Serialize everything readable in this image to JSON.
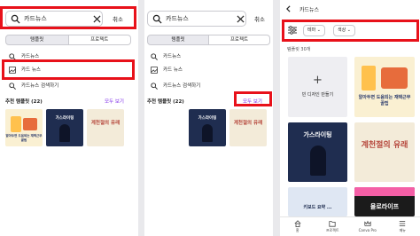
{
  "colors": {
    "accent": "#7d2ae8",
    "highlight": "#e8111a"
  },
  "screen1": {
    "search_value": "카드뉴스",
    "cancel_label": "취소",
    "tabs": [
      "템플릿",
      "프로젝트"
    ],
    "suggestions": [
      "카드뉴스",
      "카드 뉴스",
      "카드뉴스 검색하기"
    ],
    "recommended_title": "추천 템플릿 (22)",
    "see_all": "모두 보기",
    "thumbnails": [
      {
        "title": "알아두면 도움되는 재택근무 꿀팁"
      },
      {
        "title": "가스라이팅"
      },
      {
        "title": "계천절의 유래"
      }
    ]
  },
  "screen2": {
    "search_value": "카드뉴스",
    "cancel_label": "취소",
    "tabs": [
      "템플릿",
      "프로젝트"
    ],
    "suggestions": [
      "카드뉴스",
      "카드 뉴스",
      "카드뉴스 검색하기"
    ],
    "recommended_title": "추천 템플릿 (22)",
    "see_all": "모두 보기",
    "thumbnails": [
      {
        "title": "가스라이팅"
      },
      {
        "title": "계천절의 유래"
      }
    ]
  },
  "screen3": {
    "header_title": "카드뉴스",
    "filters": [
      "테마",
      "색상"
    ],
    "count_label": "템플릿 30개",
    "blank_label": "빈 디자인 만들기",
    "thumbnails": [
      {
        "title": "알아두면 도움되는 재택근무 꿀팁"
      },
      {
        "title": "가스라이팅"
      },
      {
        "title": "계천절의 유래"
      },
      {
        "title": "욜로라이프"
      },
      {
        "title": "키보드 요약 ..."
      }
    ],
    "nav": [
      "홈",
      "프로젝트",
      "Canva Pro",
      "메뉴"
    ]
  }
}
